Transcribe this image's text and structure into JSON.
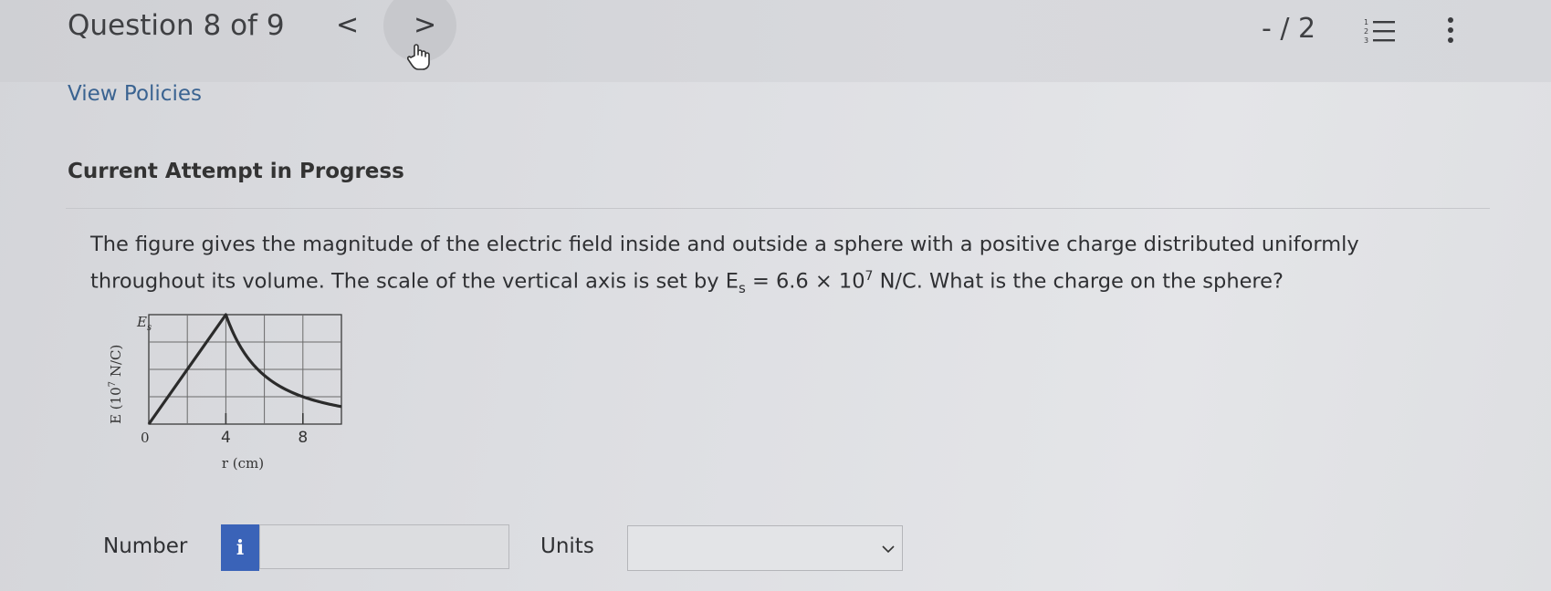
{
  "header": {
    "question_title": "Question 8 of 9",
    "prev_symbol": "<",
    "next_symbol": ">",
    "score": "- / 2"
  },
  "links": {
    "view_policies": "View Policies"
  },
  "attempt_heading": "Current Attempt in Progress",
  "question": {
    "text_before": "The figure gives the magnitude of the electric field inside and outside a sphere with a positive charge distributed uniformly throughout its volume. The scale of the vertical axis is set by E",
    "subscript": "s",
    "text_middle": " = 6.6 × 10",
    "superscript": "7",
    "text_after": " N/C. What is the charge on the sphere?"
  },
  "figure": {
    "y_label_base": "E (10",
    "y_label_sup": "7",
    "y_label_end": " N/C)",
    "y_top_label": "E",
    "y_top_sub": "s",
    "origin_label": "0",
    "x_tick_labels": [
      "4",
      "8"
    ],
    "x_label": "r (cm)"
  },
  "chart_data": {
    "type": "line",
    "xlabel": "r (cm)",
    "ylabel": "E (10^7 N/C)",
    "xlim": [
      0,
      10
    ],
    "ylim": [
      0,
      6.6
    ],
    "x": [
      0,
      4,
      5,
      6,
      7,
      8,
      9,
      10
    ],
    "y": [
      0,
      6.6,
      4.22,
      2.93,
      2.16,
      1.65,
      1.3,
      1.06
    ],
    "grid": true
  },
  "answer": {
    "number_label": "Number",
    "info_button": "i",
    "number_value": "",
    "units_label": "Units",
    "units_selected": ""
  },
  "colors": {
    "accent": "#3a63b8",
    "link": "#3a6391"
  },
  "icons": {
    "prev": "chevron-left-icon",
    "next": "chevron-right-icon",
    "cursor": "hand-pointer-icon",
    "list": "numbered-list-icon",
    "more": "more-vertical-icon",
    "dropdown": "chevron-down-icon"
  }
}
